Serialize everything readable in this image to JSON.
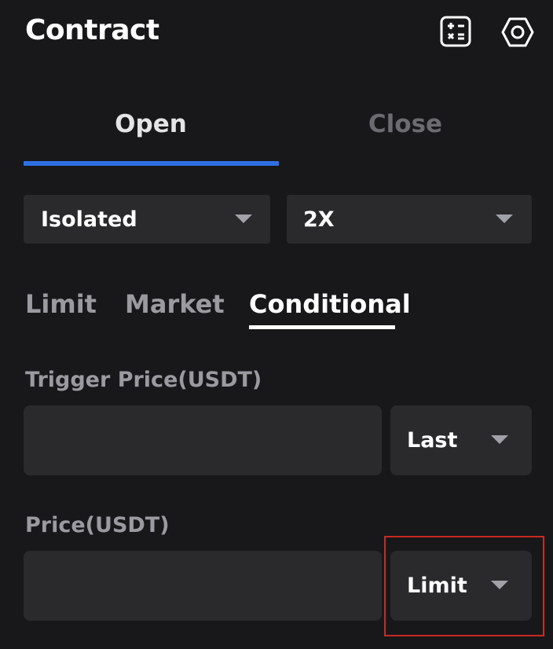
{
  "header": {
    "title": "Contract",
    "icons": [
      "calculator-icon",
      "gear-icon"
    ]
  },
  "tabs": [
    {
      "label": "Open",
      "active": true
    },
    {
      "label": "Close",
      "active": false
    }
  ],
  "margin_mode": {
    "selected": "Isolated"
  },
  "leverage": {
    "selected": "2X"
  },
  "order_types": [
    {
      "label": "Limit",
      "active": false
    },
    {
      "label": "Market",
      "active": false
    },
    {
      "label": "Conditional",
      "active": true
    }
  ],
  "trigger_price": {
    "label": "Trigger Price(USDT)",
    "value": "",
    "price_type": "Last"
  },
  "price": {
    "label": "Price(USDT)",
    "value": "",
    "price_type": "Limit"
  },
  "colors": {
    "background": "#18181b",
    "control_bg": "#2a2a2d",
    "accent_blue": "#2f6fe4",
    "muted_text": "#9a9aa0",
    "highlight_red": "#c62a21"
  }
}
